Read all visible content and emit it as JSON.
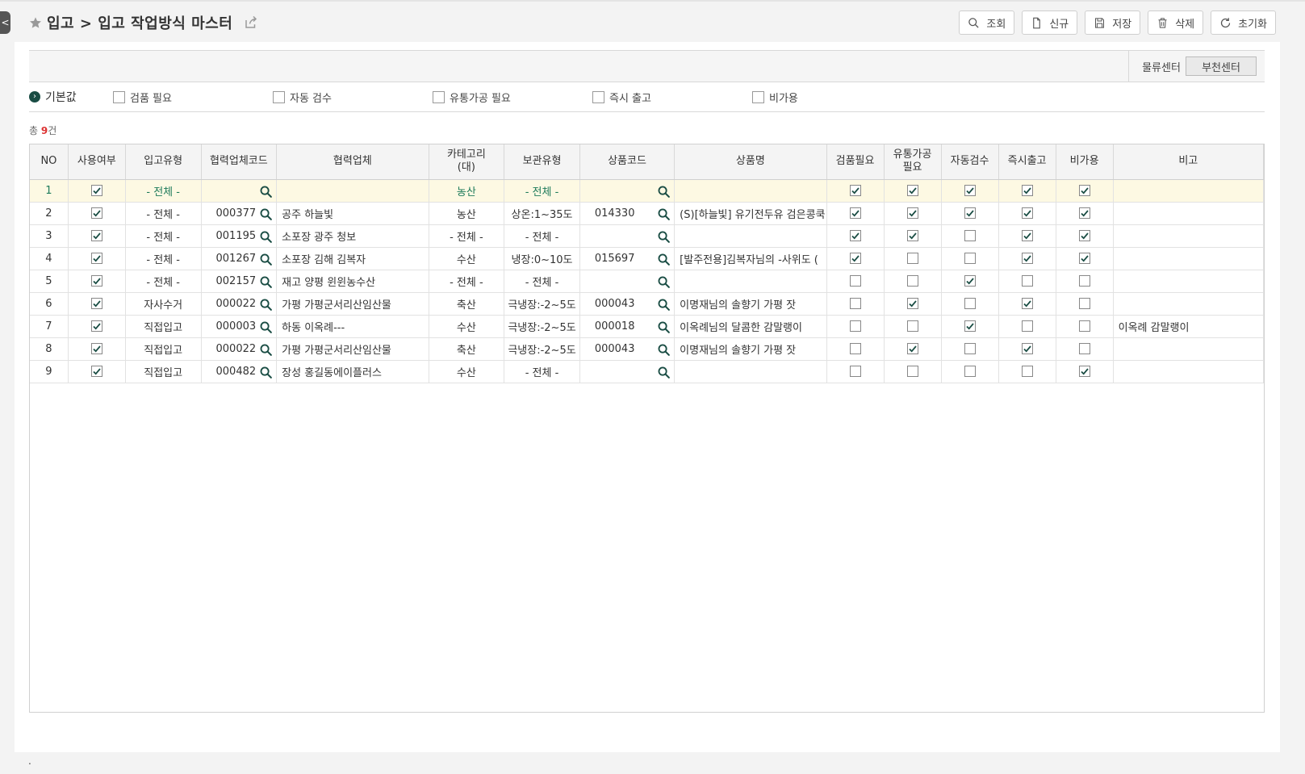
{
  "title": "입고 > 입고 작업방식 마스터",
  "toolbar": {
    "search": "조회",
    "new": "신규",
    "save": "저장",
    "delete": "삭제",
    "reset": "초기화"
  },
  "center": {
    "label": "물류센터",
    "value": "부천센터"
  },
  "defaults": {
    "label": "기본값",
    "options": [
      "검품 필요",
      "자동 검수",
      "유통가공 필요",
      "즉시 출고",
      "비가용"
    ]
  },
  "count": {
    "prefix": "총 ",
    "value": "9",
    "suffix": "건"
  },
  "columns": [
    "NO",
    "사용여부",
    "입고유형",
    "협력업체코드",
    "협력업체",
    "카테고리\n(대)",
    "보관유형",
    "상품코드",
    "상품명",
    "검품필요",
    "유통가공\n필요",
    "자동검수",
    "즉시출고",
    "비가용",
    "비고"
  ],
  "rows": [
    {
      "no": "1",
      "use": true,
      "type": "- 전체 -",
      "vcode": "",
      "vendor": "",
      "cat": "농산",
      "storage": "- 전체 -",
      "pcode": "",
      "pname": "",
      "insp": true,
      "proc": true,
      "auto": true,
      "imm": true,
      "unavail": true,
      "note": ""
    },
    {
      "no": "2",
      "use": true,
      "type": "- 전체 -",
      "vcode": "000377",
      "vendor": "공주 하늘빛",
      "cat": "농산",
      "storage": "상온:1~35도",
      "pcode": "014330",
      "pname": "(S)[하늘빛] 유기전두유 검은콩쿡",
      "insp": true,
      "proc": true,
      "auto": true,
      "imm": true,
      "unavail": true,
      "note": ""
    },
    {
      "no": "3",
      "use": true,
      "type": "- 전체 -",
      "vcode": "001195",
      "vendor": "소포장 광주 청보",
      "cat": "- 전체 -",
      "storage": "- 전체 -",
      "pcode": "",
      "pname": "",
      "insp": true,
      "proc": true,
      "auto": false,
      "imm": true,
      "unavail": true,
      "note": ""
    },
    {
      "no": "4",
      "use": true,
      "type": "- 전체 -",
      "vcode": "001267",
      "vendor": "소포장 김해 김복자",
      "cat": "수산",
      "storage": "냉장:0~10도",
      "pcode": "015697",
      "pname": "[발주전용]김복자님의 -사위도 (",
      "insp": true,
      "proc": false,
      "auto": false,
      "imm": true,
      "unavail": true,
      "note": ""
    },
    {
      "no": "5",
      "use": true,
      "type": "- 전체 -",
      "vcode": "002157",
      "vendor": "재고 양평 윈윈농수산",
      "cat": "- 전체 -",
      "storage": "- 전체 -",
      "pcode": "",
      "pname": "",
      "insp": false,
      "proc": false,
      "auto": true,
      "imm": false,
      "unavail": false,
      "note": ""
    },
    {
      "no": "6",
      "use": true,
      "type": "자사수거",
      "vcode": "000022",
      "vendor": "가평 가평군서리산임산물",
      "cat": "축산",
      "storage": "극냉장:-2~5도",
      "pcode": "000043",
      "pname": "이명재님의 솔향기 가평 잣",
      "insp": false,
      "proc": true,
      "auto": false,
      "imm": true,
      "unavail": false,
      "note": ""
    },
    {
      "no": "7",
      "use": true,
      "type": "직접입고",
      "vcode": "000003",
      "vendor": "하동 이옥례---",
      "cat": "수산",
      "storage": "극냉장:-2~5도",
      "pcode": "000018",
      "pname": "이옥례님의 달콤한 감말랭이",
      "insp": false,
      "proc": false,
      "auto": true,
      "imm": false,
      "unavail": false,
      "note": "이옥례 감말랭이"
    },
    {
      "no": "8",
      "use": true,
      "type": "직접입고",
      "vcode": "000022",
      "vendor": "가평 가평군서리산임산물",
      "cat": "축산",
      "storage": "극냉장:-2~5도",
      "pcode": "000043",
      "pname": "이명재님의 솔향기 가평 잣",
      "insp": false,
      "proc": true,
      "auto": false,
      "imm": true,
      "unavail": false,
      "note": ""
    },
    {
      "no": "9",
      "use": true,
      "type": "직접입고",
      "vcode": "000482",
      "vendor": "장성 홍길동에이플러스",
      "cat": "수산",
      "storage": "- 전체 -",
      "pcode": "",
      "pname": "",
      "insp": false,
      "proc": false,
      "auto": false,
      "imm": false,
      "unavail": true,
      "note": ""
    }
  ],
  "footer": ".",
  "colors": {
    "accent": "#1a4d44",
    "firstRow": "#fdf9e3",
    "countRed": "#d33"
  }
}
